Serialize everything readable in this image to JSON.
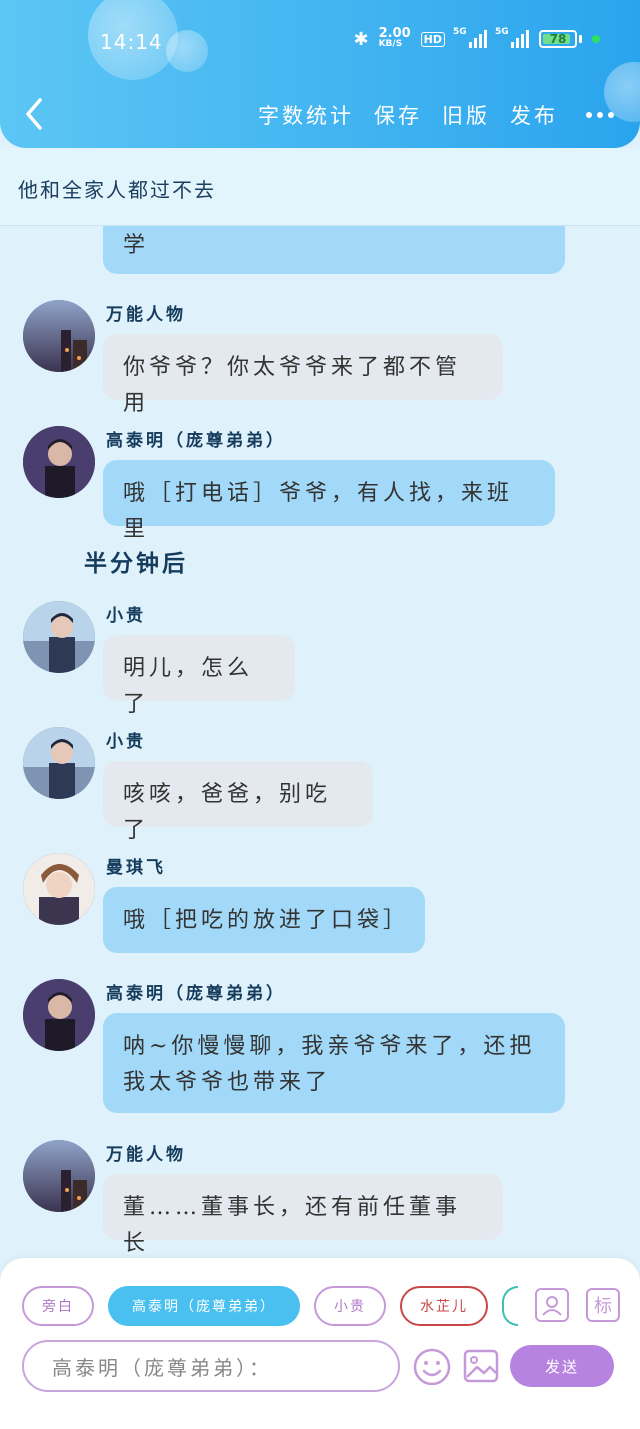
{
  "status_bar": {
    "time": "14:14",
    "net_speed_value": "2.00",
    "net_speed_unit": "KB/S",
    "hd_label": "HD",
    "signal1_label": "5G",
    "signal2_label": "5G",
    "battery_level": "78"
  },
  "nav": {
    "actions": [
      "字数统计",
      "保存",
      "旧版",
      "发布"
    ]
  },
  "chat_title": "他和全家人都过不去",
  "messages": [
    {
      "speaker": "",
      "text": "学",
      "style": "blue"
    },
    {
      "speaker": "万能人物",
      "text": "你爷爷？你太爷爷来了都不管用",
      "style": "gray"
    },
    {
      "speaker": "高泰明（庞尊弟弟）",
      "text": "哦［打电话］爷爷，有人找，来班里",
      "style": "blue"
    },
    {
      "narration": "半分钟后"
    },
    {
      "speaker": "小贵",
      "text": "明儿，怎么了",
      "style": "gray"
    },
    {
      "speaker": "小贵",
      "text": "咳咳，爸爸，别吃了",
      "style": "gray"
    },
    {
      "speaker": "曼琪飞",
      "text": "哦［把吃的放进了口袋］",
      "style": "blue"
    },
    {
      "speaker": "高泰明（庞尊弟弟）",
      "text_lines": [
        "呐~你慢慢聊，我亲爷爷来了，还把",
        "我太爷爷也带来了"
      ],
      "style": "blue"
    },
    {
      "speaker": "万能人物",
      "text": "董……董事长，还有前任董事长",
      "style": "gray"
    }
  ],
  "bottom": {
    "chips": [
      "旁白",
      "高泰明（庞尊弟弟）",
      "小贵",
      "水芷儿"
    ],
    "tool_label": "标",
    "input_placeholder": "高泰明（庞尊弟弟）：",
    "send_label": "发送"
  },
  "colors": {
    "header": "#3fb2f0",
    "bubble_blue": "#a3d9f8",
    "bubble_gray": "#e4e9ef",
    "accent_purple": "#b783e0"
  }
}
